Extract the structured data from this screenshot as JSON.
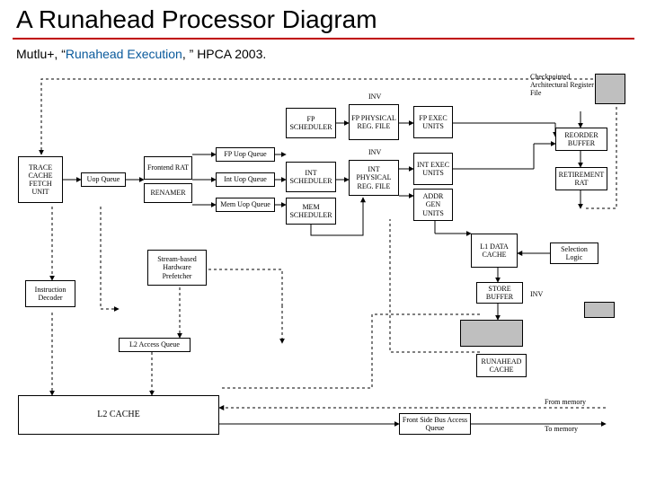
{
  "title": "A Runahead Processor Diagram",
  "citation": {
    "prefix": "Mutlu+, “",
    "link": "Runahead Execution",
    "suffix": ", ” HPCA 2003."
  },
  "boxes": {
    "trace_cache_fetch": "TRACE\nCACHE\nFETCH\nUNIT",
    "uop_queue": "Uop Queue",
    "frontend_rat": "Frontend\nRAT",
    "renamer": "RENAMER",
    "fp_uop_q": "FP Uop Queue",
    "int_uop_q": "Int Uop Queue",
    "mem_uop_q": "Mem Uop Queue",
    "fp_sched": "FP\nSCHEDULER",
    "int_sched": "INT\nSCHEDULER",
    "mem_sched": "MEM\nSCHEDULER",
    "fp_prf": "FP\nPHYSICAL\nREG. FILE",
    "int_prf": "INT\nPHYSICAL\nREG. FILE",
    "fp_exec": "FP\nEXEC\nUNITS",
    "int_exec": "INT\nEXEC\nUNITS",
    "addr_gen": "ADDR\nGEN\nUNITS",
    "checkpointed": "Checkpointed\nArchitectural\nRegister File",
    "reorder": "REORDER\nBUFFER",
    "l1d": "L1\nDATA\nCACHE",
    "retire_rat": "RETIREMENT\nRAT",
    "sel_logic": "Selection\nLogic",
    "store_buf": "STORE\nBUFFER",
    "runahead_cache": "RUNAHEAD\nCACHE",
    "instr_decoder": "Instruction\nDecoder",
    "prefetcher": "Stream-based\nHardware\nPrefetcher",
    "l2_access_q": "L2 Access Queue",
    "l2_cache": "L2 CACHE",
    "fsb_q": "Front Side Bus\nAccess Queue"
  },
  "labels": {
    "inv1": "INV",
    "inv2": "INV",
    "from_mem": "From memory",
    "to_mem": "To memory"
  }
}
